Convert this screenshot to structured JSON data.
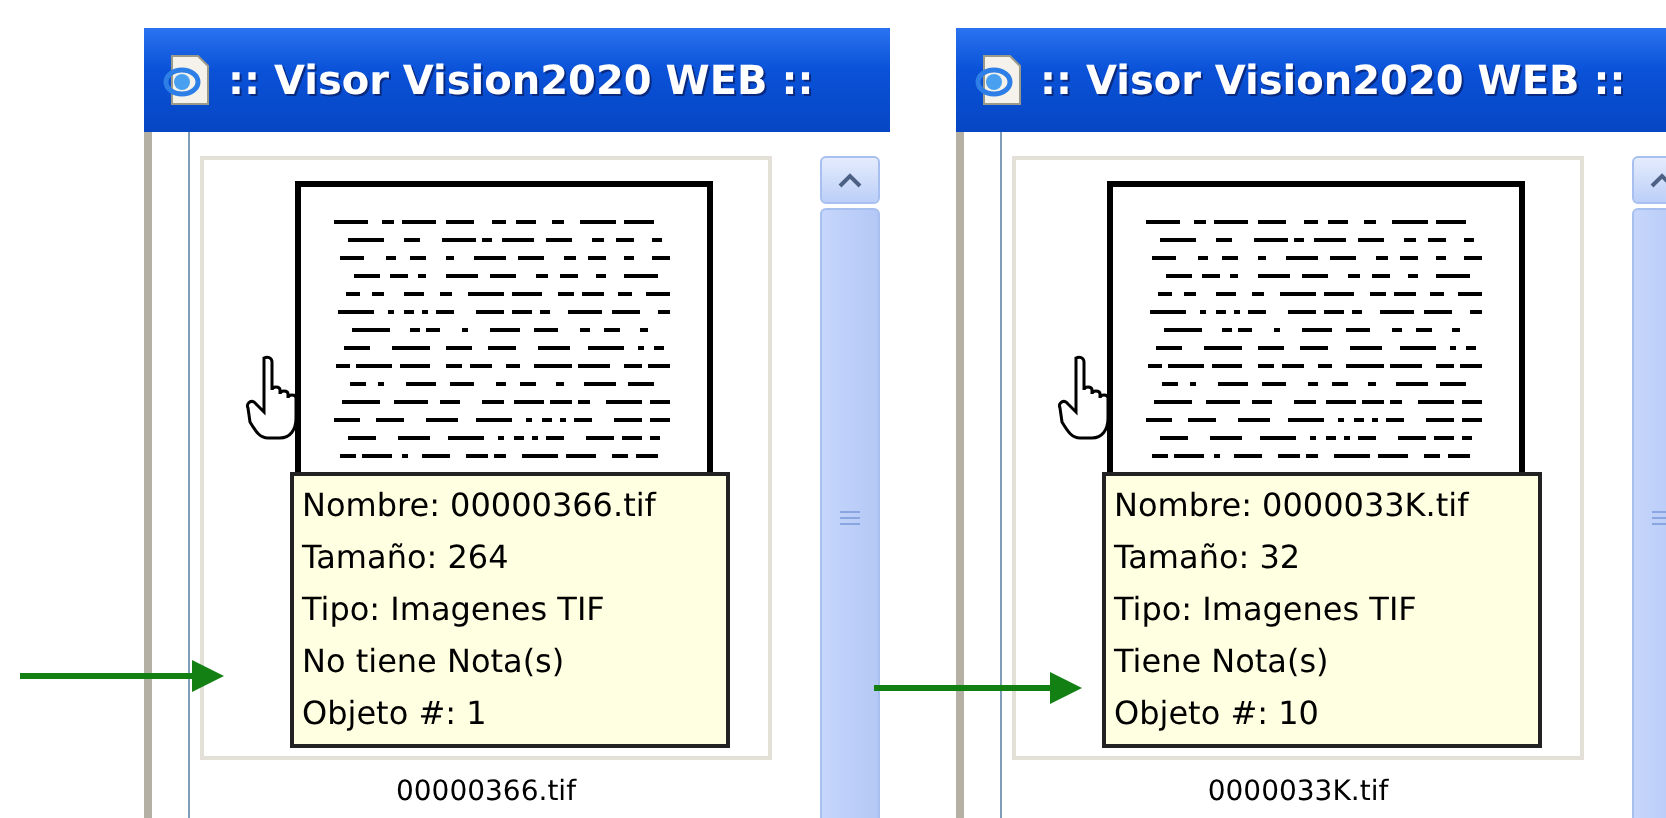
{
  "windows": [
    {
      "title": ":: Visor Vision2020 WEB ::",
      "tooltip": [
        "Nombre: 00000366.tif",
        "Tamaño: 264",
        "Tipo: Imagenes TIF",
        "No tiene Nota(s)",
        "Objeto #: 1"
      ],
      "file_label": "00000366.tif"
    },
    {
      "title": ":: Visor Vision2020 WEB ::",
      "tooltip": [
        "Nombre: 0000033K.tif",
        "Tamaño: 32",
        "Tipo: Imagenes TIF",
        "Tiene Nota(s)",
        "Objeto #: 10"
      ],
      "file_label": "0000033K.tif"
    }
  ]
}
